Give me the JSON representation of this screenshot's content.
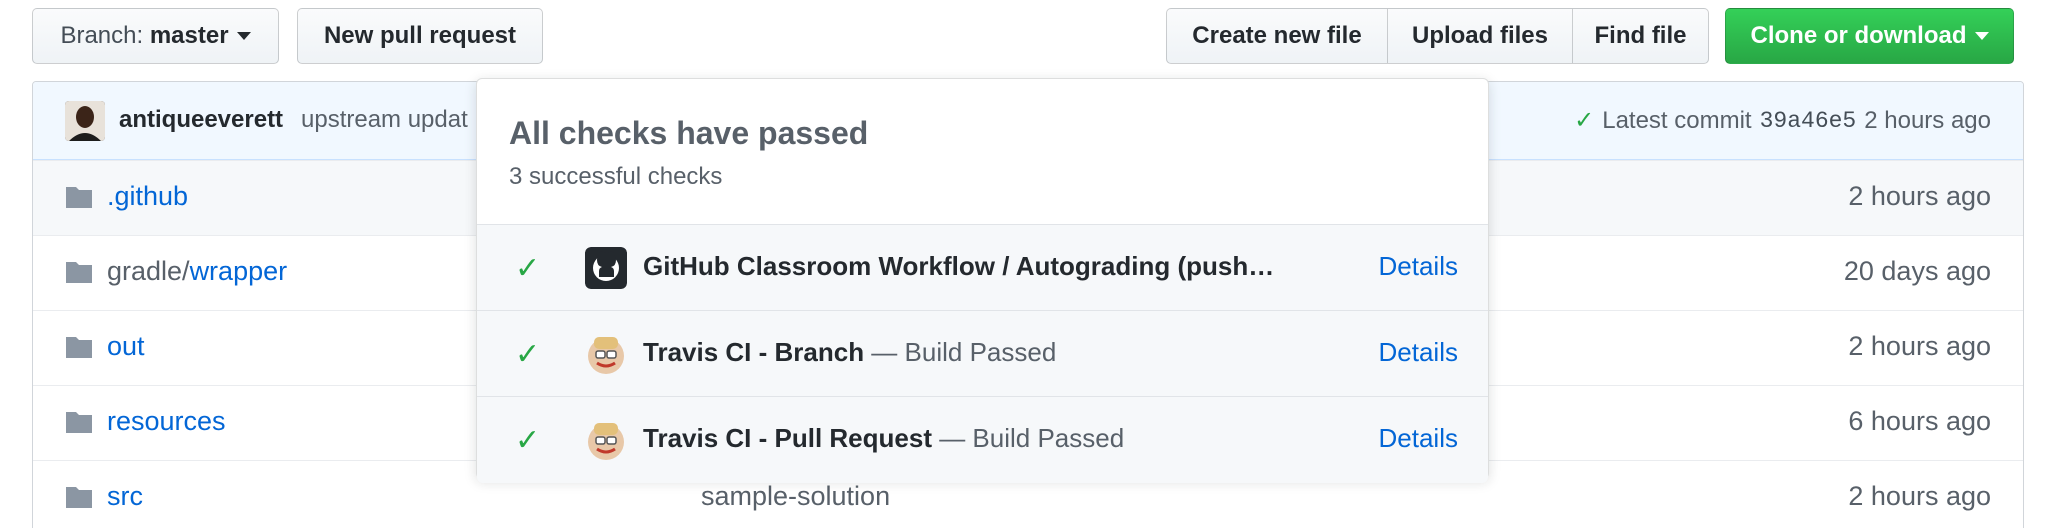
{
  "toolbar": {
    "branch_prefix": "Branch:",
    "branch_name": "master",
    "new_pr": "New pull request",
    "create_file": "Create new file",
    "upload_files": "Upload files",
    "find_file": "Find file",
    "clone": "Clone or download"
  },
  "commit": {
    "user": "antiqueeverett",
    "message": "upstream updat",
    "latest_label": "Latest commit",
    "sha": "39a46e5",
    "age": "2 hours ago"
  },
  "files": [
    {
      "prefix": "",
      "name": ".github",
      "message": "",
      "age": "2 hours ago"
    },
    {
      "prefix": "gradle/",
      "name": "wrapper",
      "message": "",
      "age": "20 days ago"
    },
    {
      "prefix": "",
      "name": "out",
      "message": "",
      "age": "2 hours ago"
    },
    {
      "prefix": "",
      "name": "resources",
      "message": "",
      "age": "6 hours ago"
    },
    {
      "prefix": "",
      "name": "src",
      "message": "sample-solution",
      "age": "2 hours ago"
    }
  ],
  "checks": {
    "title": "All checks have passed",
    "subtitle": "3 successful checks",
    "items": [
      {
        "name": "GitHub Classroom Workflow / Autograding (push…",
        "desc": "",
        "details": "Details",
        "icon": "github-icon"
      },
      {
        "name": "Travis CI - Branch",
        "desc": " — Build Passed",
        "details": "Details",
        "icon": "travis-ci-icon"
      },
      {
        "name": "Travis CI - Pull Request",
        "desc": " — Build Passed",
        "details": "Details",
        "icon": "travis-ci-icon"
      }
    ]
  },
  "colors": {
    "success": "#28a745",
    "link": "#0366d6",
    "clone_button": "#2ea44f"
  }
}
